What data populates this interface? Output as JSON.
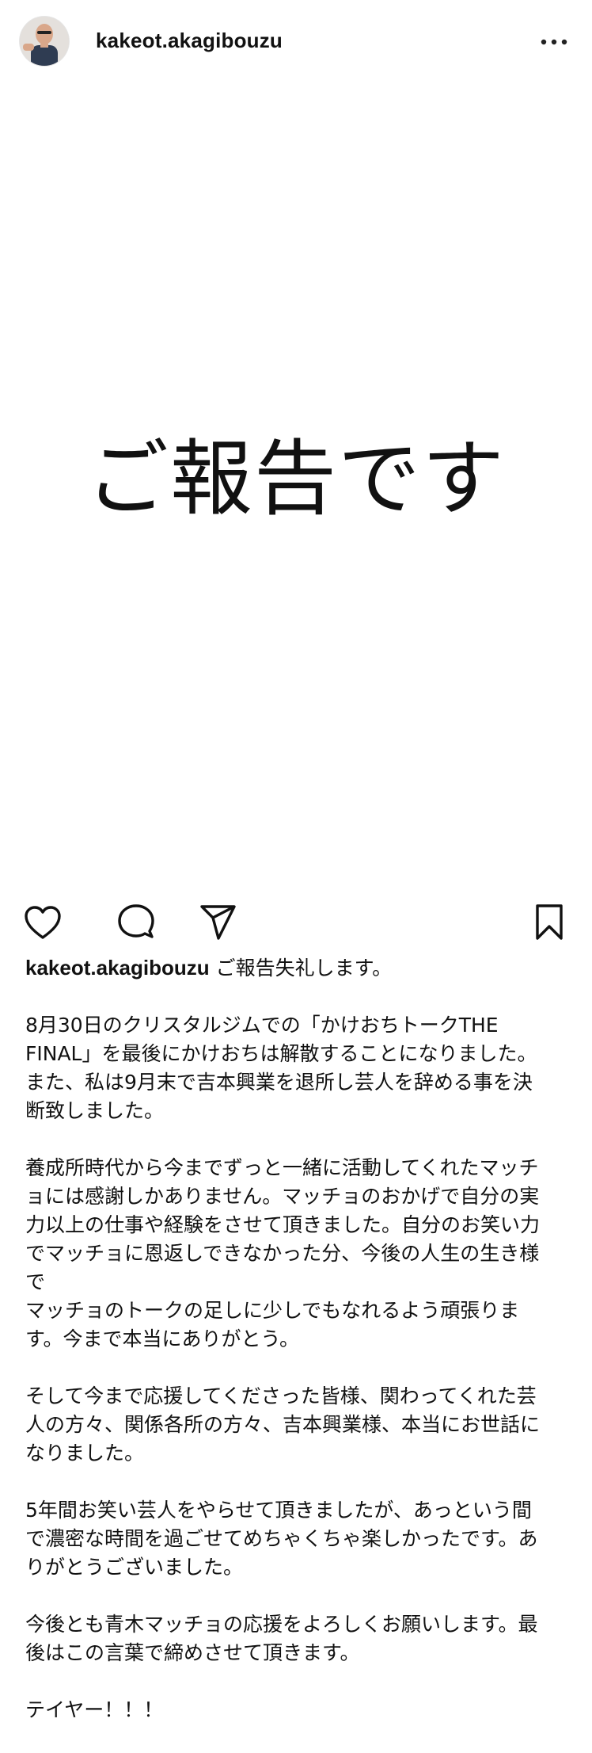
{
  "header": {
    "username": "kakeot.akagibouzu",
    "avatar_icon": "profile-photo",
    "more_icon": "more-horizontal-icon"
  },
  "post": {
    "image_text": "ご報告です"
  },
  "actions": {
    "like_icon": "heart-icon",
    "comment_icon": "comment-icon",
    "share_icon": "send-icon",
    "save_icon": "bookmark-icon"
  },
  "caption": {
    "username": "kakeot.akagibouzu",
    "first_text": " ご報告失礼します。",
    "paragraphs": [
      "8月30日のクリスタルジムでの「かけおちトークTHE\nFINAL」を最後にかけおちは解散することになりました。\nまた、私は9月末で吉本興業を退所し芸人を辞める事を決\n断致しました。",
      "養成所時代から今までずっと一緒に活動してくれたマッチ\nョには感謝しかありません。マッチョのおかげで自分の実\n力以上の仕事や経験をさせて頂きました。自分のお笑い力\nでマッチョに恩返しできなかった分、今後の人生の生き様\nで\nマッチョのトークの足しに少しでもなれるよう頑張りま\nす。今まで本当にありがとう。",
      "そして今まで応援してくださった皆様、関わってくれた芸\n人の方々、関係各所の方々、吉本興業様、本当にお世話に\nなりました。",
      "5年間お笑い芸人をやらせて頂きましたが、あっという間\nで濃密な時間を過ごせてめちゃくちゃ楽しかったです。あ\nりがとうございました。",
      "今後とも青木マッチョの応援をよろしくお願いします。最\n後はこの言葉で締めさせて頂きます。",
      "テイヤー！！！"
    ]
  }
}
